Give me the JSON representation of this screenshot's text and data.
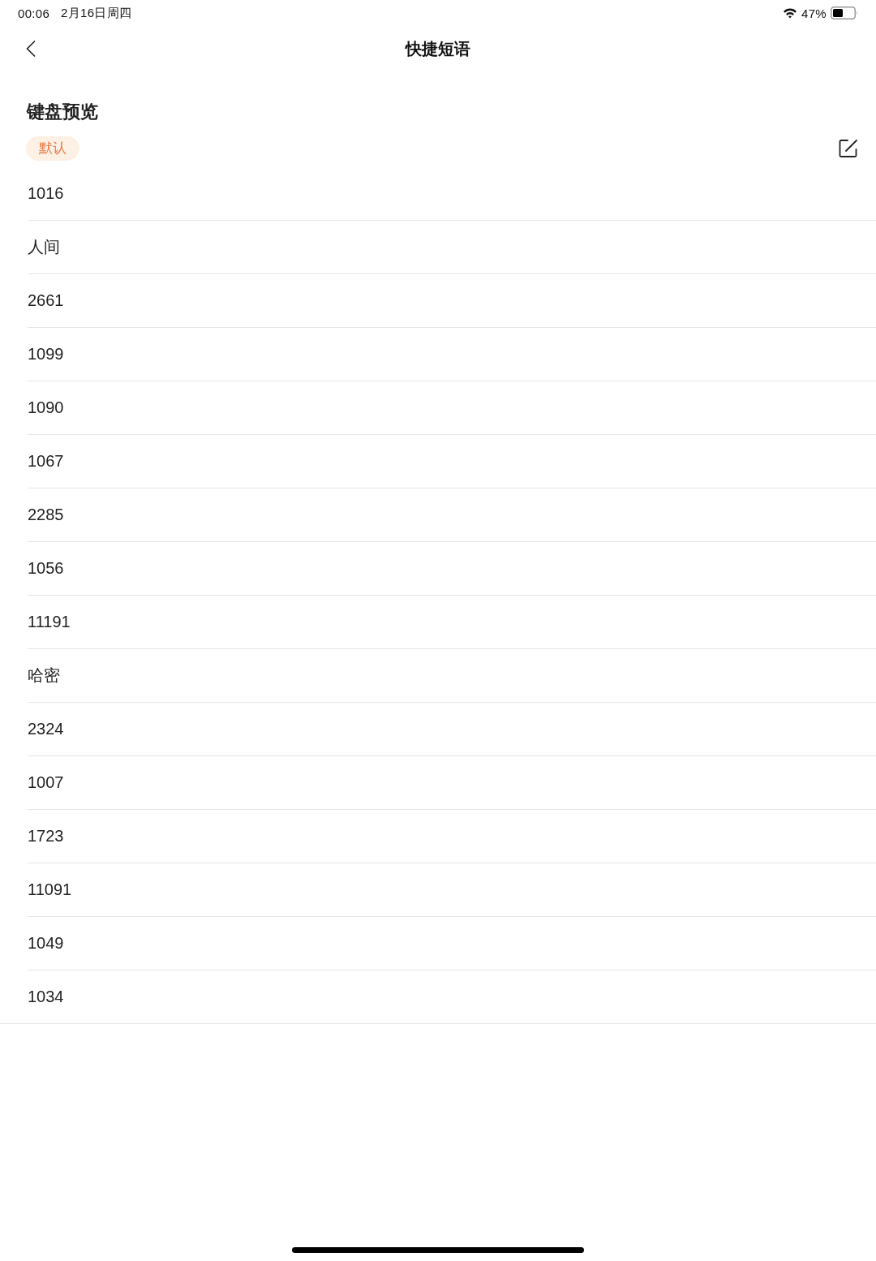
{
  "status_bar": {
    "time": "00:06",
    "date": "2月16日周四",
    "battery": "47%"
  },
  "nav_bar": {
    "title": "快捷短语"
  },
  "section": {
    "title": "键盘预览",
    "badge": "默认"
  },
  "phrases": [
    {
      "text": "1016"
    },
    {
      "text": "人间"
    },
    {
      "text": "2661"
    },
    {
      "text": "1099"
    },
    {
      "text": "1090"
    },
    {
      "text": "1067"
    },
    {
      "text": "2285"
    },
    {
      "text": "1056"
    },
    {
      "text": "11191"
    },
    {
      "text": "哈密"
    },
    {
      "text": "2324"
    },
    {
      "text": "1007"
    },
    {
      "text": "1723"
    },
    {
      "text": "11091"
    },
    {
      "text": "1049"
    },
    {
      "text": "1034"
    }
  ]
}
